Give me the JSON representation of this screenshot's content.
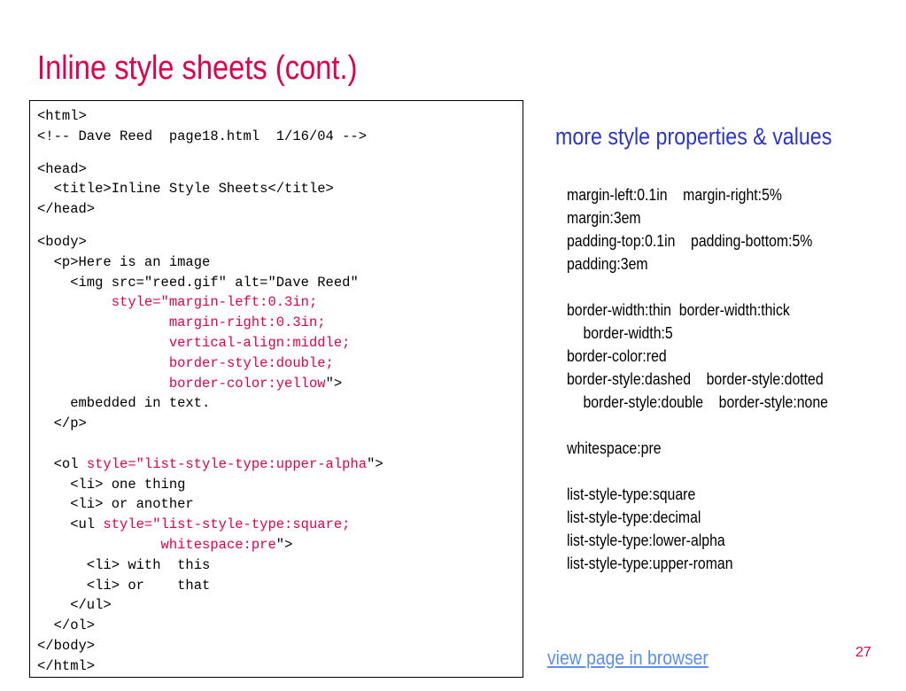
{
  "slide": {
    "title": "Inline style sheets (cont.)",
    "page_number": "27"
  },
  "code": {
    "lines": [
      {
        "parts": [
          {
            "t": "<html>"
          }
        ]
      },
      {
        "parts": [
          {
            "t": "<!-- Dave Reed  page18.html  1/16/04 -->"
          }
        ],
        "gap": true
      },
      {
        "parts": [
          {
            "t": "<head>"
          }
        ]
      },
      {
        "parts": [
          {
            "t": "  <title>Inline Style Sheets</title>"
          }
        ]
      },
      {
        "parts": [
          {
            "t": "</head>"
          }
        ],
        "gap": true
      },
      {
        "parts": [
          {
            "t": "<body>"
          }
        ]
      },
      {
        "parts": [
          {
            "t": "  <p>Here is an image"
          }
        ]
      },
      {
        "parts": [
          {
            "t": "    <img src=\"reed.gif\" alt=\"Dave Reed\""
          }
        ]
      },
      {
        "parts": [
          {
            "t": "         "
          },
          {
            "t": "style=\"margin-left:0.3in;",
            "hl": true
          }
        ]
      },
      {
        "parts": [
          {
            "t": "                "
          },
          {
            "t": "margin-right:0.3in;",
            "hl": true
          }
        ]
      },
      {
        "parts": [
          {
            "t": "                "
          },
          {
            "t": "vertical-align:middle;",
            "hl": true
          }
        ]
      },
      {
        "parts": [
          {
            "t": "                "
          },
          {
            "t": "border-style:double;",
            "hl": true
          }
        ]
      },
      {
        "parts": [
          {
            "t": "                "
          },
          {
            "t": "border-color:yellow",
            "hl": true
          },
          {
            "t": "\">"
          }
        ]
      },
      {
        "parts": [
          {
            "t": "    embedded in text."
          }
        ]
      },
      {
        "parts": [
          {
            "t": "  </p>"
          }
        ]
      },
      {
        "parts": [],
        "blank": true
      },
      {
        "parts": [
          {
            "t": "  <ol "
          },
          {
            "t": "style=\"list-style-type:upper-alpha",
            "hl": true
          },
          {
            "t": "\">"
          }
        ]
      },
      {
        "parts": [
          {
            "t": "    <li> one thing"
          }
        ]
      },
      {
        "parts": [
          {
            "t": "    <li> or another"
          }
        ]
      },
      {
        "parts": [
          {
            "t": "    <ul "
          },
          {
            "t": "style=\"list-style-type:square;",
            "hl": true
          }
        ]
      },
      {
        "parts": [
          {
            "t": "               "
          },
          {
            "t": "whitespace:pre",
            "hl": true
          },
          {
            "t": "\">"
          }
        ]
      },
      {
        "parts": [
          {
            "t": "      <li> with  this"
          }
        ]
      },
      {
        "parts": [
          {
            "t": "      <li> or    that"
          }
        ]
      },
      {
        "parts": [
          {
            "t": "    </ul>"
          }
        ]
      },
      {
        "parts": [
          {
            "t": "  </ol>"
          }
        ]
      },
      {
        "parts": [
          {
            "t": "</body>"
          }
        ]
      },
      {
        "parts": [
          {
            "t": "</html>"
          }
        ]
      }
    ]
  },
  "properties": {
    "heading": "more style properties & values",
    "lines": [
      {
        "text": "margin-left:0.1in    margin-right:5%"
      },
      {
        "text": "margin:3em"
      },
      {
        "text": "padding-top:0.1in    padding-bottom:5%"
      },
      {
        "text": "padding:3em"
      },
      {
        "text": "",
        "blank": true
      },
      {
        "text": "border-width:thin  border-width:thick"
      },
      {
        "text": "border-width:5",
        "indent": true
      },
      {
        "text": "border-color:red"
      },
      {
        "text": "border-style:dashed    border-style:dotted"
      },
      {
        "text": "border-style:double    border-style:none",
        "indent": true
      },
      {
        "text": "",
        "blank": true
      },
      {
        "text": "whitespace:pre"
      },
      {
        "text": "",
        "blank": true
      },
      {
        "text": "list-style-type:square"
      },
      {
        "text": "list-style-type:decimal"
      },
      {
        "text": "list-style-type:lower-alpha"
      },
      {
        "text": "list-style-type:upper-roman"
      }
    ]
  },
  "link": {
    "label": "view page in browser"
  },
  "colors": {
    "title": "#e0004d",
    "code_highlight": "#e0004d",
    "heading": "#2b35c8",
    "link": "#5b8ef0",
    "page_number": "#e0004d"
  }
}
